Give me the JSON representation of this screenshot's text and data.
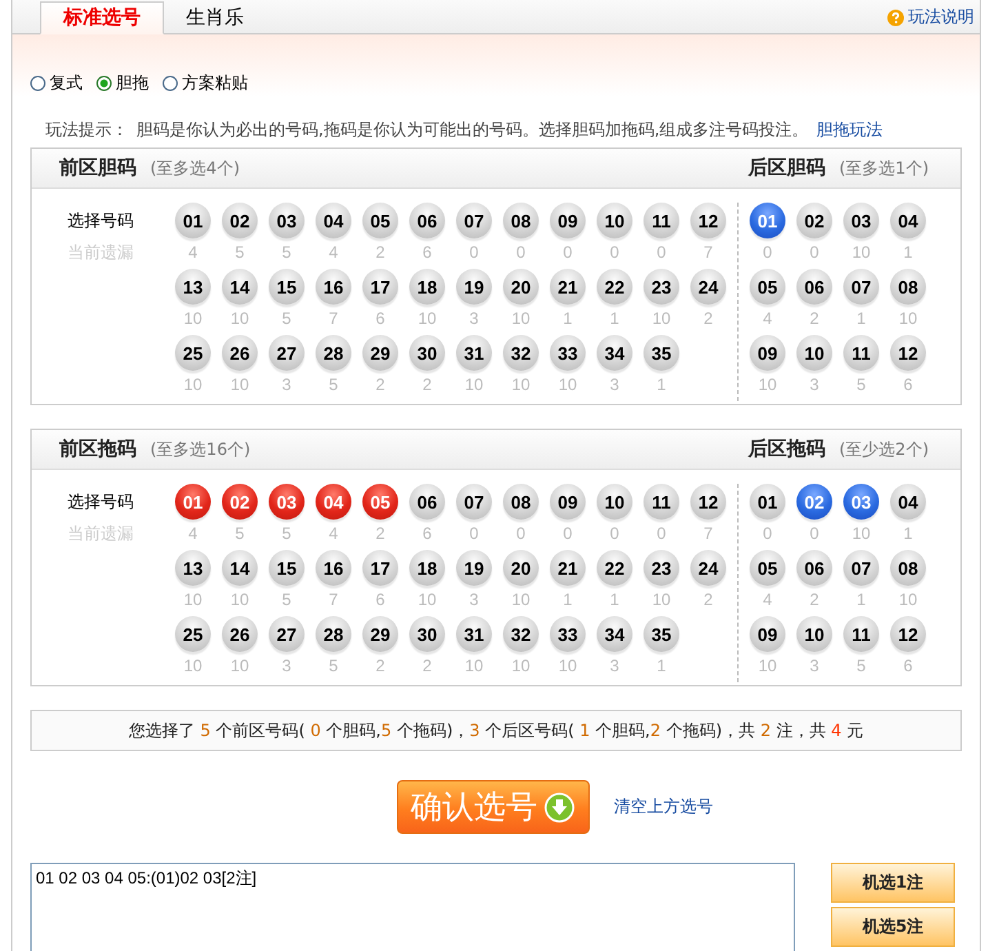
{
  "tabs": [
    {
      "label": "标准选号",
      "selected": true
    },
    {
      "label": "生肖乐",
      "selected": false
    }
  ],
  "help_link": "玩法说明",
  "modes": [
    {
      "label": "复式",
      "selected": false
    },
    {
      "label": "胆拖",
      "selected": true
    },
    {
      "label": "方案粘贴",
      "selected": false
    }
  ],
  "tip": {
    "label": "玩法提示：",
    "text": "胆码是你认为必出的号码,拖码是你认为可能出的号码。选择胆码加拖码,组成多注号码投注。",
    "link": "胆拖玩法"
  },
  "panels": [
    {
      "front": {
        "title": "前区胆码",
        "limit": "(至多选4个)",
        "row_label": "选择号码",
        "miss_label": "当前遗漏",
        "balls": [
          {
            "number": "01",
            "miss": "4",
            "selected": false
          },
          {
            "number": "02",
            "miss": "5",
            "selected": false
          },
          {
            "number": "03",
            "miss": "5",
            "selected": false
          },
          {
            "number": "04",
            "miss": "4",
            "selected": false
          },
          {
            "number": "05",
            "miss": "2",
            "selected": false
          },
          {
            "number": "06",
            "miss": "6",
            "selected": false
          },
          {
            "number": "07",
            "miss": "0",
            "selected": false
          },
          {
            "number": "08",
            "miss": "0",
            "selected": false
          },
          {
            "number": "09",
            "miss": "0",
            "selected": false
          },
          {
            "number": "10",
            "miss": "0",
            "selected": false
          },
          {
            "number": "11",
            "miss": "0",
            "selected": false
          },
          {
            "number": "12",
            "miss": "7",
            "selected": false
          },
          {
            "number": "13",
            "miss": "10",
            "selected": false
          },
          {
            "number": "14",
            "miss": "10",
            "selected": false
          },
          {
            "number": "15",
            "miss": "5",
            "selected": false
          },
          {
            "number": "16",
            "miss": "7",
            "selected": false
          },
          {
            "number": "17",
            "miss": "6",
            "selected": false
          },
          {
            "number": "18",
            "miss": "10",
            "selected": false
          },
          {
            "number": "19",
            "miss": "3",
            "selected": false
          },
          {
            "number": "20",
            "miss": "10",
            "selected": false
          },
          {
            "number": "21",
            "miss": "1",
            "selected": false
          },
          {
            "number": "22",
            "miss": "1",
            "selected": false
          },
          {
            "number": "23",
            "miss": "10",
            "selected": false
          },
          {
            "number": "24",
            "miss": "2",
            "selected": false
          },
          {
            "number": "25",
            "miss": "10",
            "selected": false
          },
          {
            "number": "26",
            "miss": "10",
            "selected": false
          },
          {
            "number": "27",
            "miss": "3",
            "selected": false
          },
          {
            "number": "28",
            "miss": "5",
            "selected": false
          },
          {
            "number": "29",
            "miss": "2",
            "selected": false
          },
          {
            "number": "30",
            "miss": "2",
            "selected": false
          },
          {
            "number": "31",
            "miss": "10",
            "selected": false
          },
          {
            "number": "32",
            "miss": "10",
            "selected": false
          },
          {
            "number": "33",
            "miss": "10",
            "selected": false
          },
          {
            "number": "34",
            "miss": "3",
            "selected": false
          },
          {
            "number": "35",
            "miss": "1",
            "selected": false
          }
        ]
      },
      "back": {
        "title": "后区胆码",
        "limit": "(至多选1个)",
        "balls": [
          {
            "number": "01",
            "miss": "0",
            "selected": true
          },
          {
            "number": "02",
            "miss": "0",
            "selected": false
          },
          {
            "number": "03",
            "miss": "10",
            "selected": false
          },
          {
            "number": "04",
            "miss": "1",
            "selected": false
          },
          {
            "number": "05",
            "miss": "4",
            "selected": false
          },
          {
            "number": "06",
            "miss": "2",
            "selected": false
          },
          {
            "number": "07",
            "miss": "1",
            "selected": false
          },
          {
            "number": "08",
            "miss": "10",
            "selected": false
          },
          {
            "number": "09",
            "miss": "10",
            "selected": false
          },
          {
            "number": "10",
            "miss": "3",
            "selected": false
          },
          {
            "number": "11",
            "miss": "5",
            "selected": false
          },
          {
            "number": "12",
            "miss": "6",
            "selected": false
          }
        ]
      }
    },
    {
      "front": {
        "title": "前区拖码",
        "limit": "(至多选16个)",
        "row_label": "选择号码",
        "miss_label": "当前遗漏",
        "balls": [
          {
            "number": "01",
            "miss": "4",
            "selected": true
          },
          {
            "number": "02",
            "miss": "5",
            "selected": true
          },
          {
            "number": "03",
            "miss": "5",
            "selected": true
          },
          {
            "number": "04",
            "miss": "4",
            "selected": true
          },
          {
            "number": "05",
            "miss": "2",
            "selected": true
          },
          {
            "number": "06",
            "miss": "6",
            "selected": false
          },
          {
            "number": "07",
            "miss": "0",
            "selected": false
          },
          {
            "number": "08",
            "miss": "0",
            "selected": false
          },
          {
            "number": "09",
            "miss": "0",
            "selected": false
          },
          {
            "number": "10",
            "miss": "0",
            "selected": false
          },
          {
            "number": "11",
            "miss": "0",
            "selected": false
          },
          {
            "number": "12",
            "miss": "7",
            "selected": false
          },
          {
            "number": "13",
            "miss": "10",
            "selected": false
          },
          {
            "number": "14",
            "miss": "10",
            "selected": false
          },
          {
            "number": "15",
            "miss": "5",
            "selected": false
          },
          {
            "number": "16",
            "miss": "7",
            "selected": false
          },
          {
            "number": "17",
            "miss": "6",
            "selected": false
          },
          {
            "number": "18",
            "miss": "10",
            "selected": false
          },
          {
            "number": "19",
            "miss": "3",
            "selected": false
          },
          {
            "number": "20",
            "miss": "10",
            "selected": false
          },
          {
            "number": "21",
            "miss": "1",
            "selected": false
          },
          {
            "number": "22",
            "miss": "1",
            "selected": false
          },
          {
            "number": "23",
            "miss": "10",
            "selected": false
          },
          {
            "number": "24",
            "miss": "2",
            "selected": false
          },
          {
            "number": "25",
            "miss": "10",
            "selected": false
          },
          {
            "number": "26",
            "miss": "10",
            "selected": false
          },
          {
            "number": "27",
            "miss": "3",
            "selected": false
          },
          {
            "number": "28",
            "miss": "5",
            "selected": false
          },
          {
            "number": "29",
            "miss": "2",
            "selected": false
          },
          {
            "number": "30",
            "miss": "2",
            "selected": false
          },
          {
            "number": "31",
            "miss": "10",
            "selected": false
          },
          {
            "number": "32",
            "miss": "10",
            "selected": false
          },
          {
            "number": "33",
            "miss": "10",
            "selected": false
          },
          {
            "number": "34",
            "miss": "3",
            "selected": false
          },
          {
            "number": "35",
            "miss": "1",
            "selected": false
          }
        ]
      },
      "back": {
        "title": "后区拖码",
        "limit": "(至少选2个)",
        "balls": [
          {
            "number": "01",
            "miss": "0",
            "selected": false
          },
          {
            "number": "02",
            "miss": "0",
            "selected": true
          },
          {
            "number": "03",
            "miss": "10",
            "selected": true
          },
          {
            "number": "04",
            "miss": "1",
            "selected": false
          },
          {
            "number": "05",
            "miss": "4",
            "selected": false
          },
          {
            "number": "06",
            "miss": "2",
            "selected": false
          },
          {
            "number": "07",
            "miss": "1",
            "selected": false
          },
          {
            "number": "08",
            "miss": "10",
            "selected": false
          },
          {
            "number": "09",
            "miss": "10",
            "selected": false
          },
          {
            "number": "10",
            "miss": "3",
            "selected": false
          },
          {
            "number": "11",
            "miss": "5",
            "selected": false
          },
          {
            "number": "12",
            "miss": "6",
            "selected": false
          }
        ]
      }
    }
  ],
  "summary": [
    {
      "text": "您选择了 ",
      "kind": "plain"
    },
    {
      "text": "5",
      "kind": "count"
    },
    {
      "text": " 个前区号码( ",
      "kind": "plain"
    },
    {
      "text": "0",
      "kind": "count"
    },
    {
      "text": " 个胆码,",
      "kind": "plain"
    },
    {
      "text": "5",
      "kind": "count"
    },
    {
      "text": " 个拖码)，",
      "kind": "plain"
    },
    {
      "text": "3",
      "kind": "count"
    },
    {
      "text": " 个后区号码( ",
      "kind": "plain"
    },
    {
      "text": "1",
      "kind": "count"
    },
    {
      "text": " 个胆码,",
      "kind": "plain"
    },
    {
      "text": "2",
      "kind": "count"
    },
    {
      "text": " 个拖码)，共 ",
      "kind": "plain"
    },
    {
      "text": "2",
      "kind": "count"
    },
    {
      "text": " 注，共 ",
      "kind": "plain"
    },
    {
      "text": "4",
      "kind": "amount"
    },
    {
      "text": " 元",
      "kind": "plain"
    }
  ],
  "confirm_button": "确认选号",
  "clear_link": "清空上方选号",
  "ticket_text": "01 02 03 04 05:(01)02 03[2注]",
  "random_buttons": [
    "机选1注",
    "机选5注"
  ]
}
